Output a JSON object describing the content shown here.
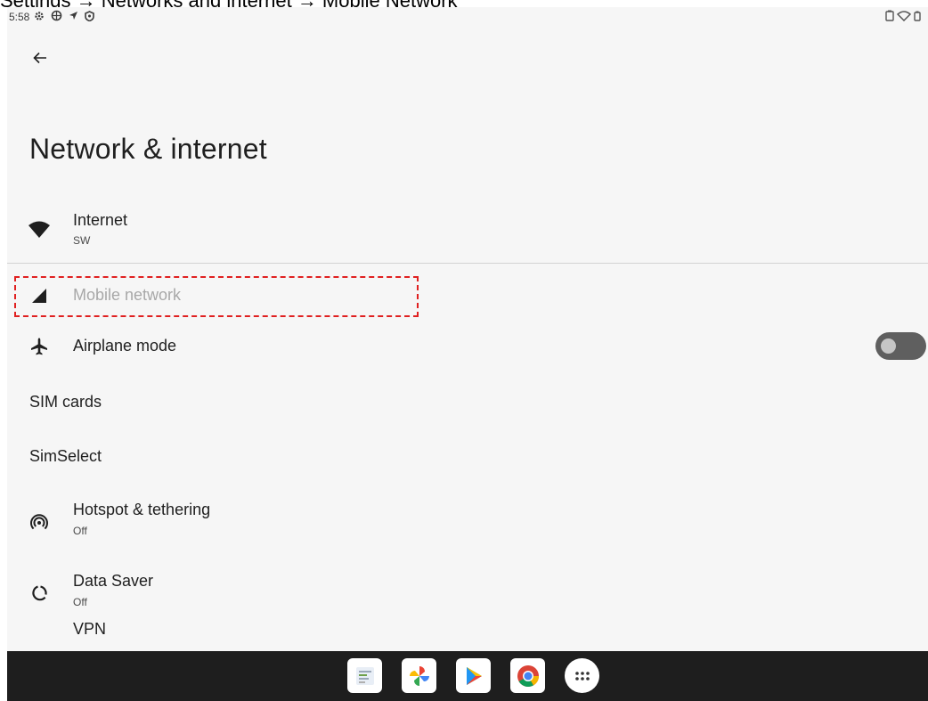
{
  "caption": "Settings → Networks and internet → Mobile Network",
  "status_bar": {
    "time": "5:58",
    "icons": [
      "settings-icon",
      "vpn-gear-icon",
      "location-arrow-icon",
      "shield-icon"
    ],
    "right_icons": [
      "battery-saver-icon",
      "wifi-icon",
      "battery-icon"
    ]
  },
  "page": {
    "title": "Network & internet"
  },
  "items": [
    {
      "title": "Internet",
      "subtitle": "SW",
      "icon": "wifi-icon"
    },
    {
      "title": "Mobile network",
      "icon": "cellular-signal-icon",
      "enabled": false
    },
    {
      "title": "Airplane mode",
      "icon": "airplane-icon",
      "toggle": false
    },
    {
      "title": "SIM cards"
    },
    {
      "title": "SimSelect"
    },
    {
      "title": "Hotspot & tethering",
      "subtitle": "Off",
      "icon": "hotspot-icon"
    },
    {
      "title": "Data Saver",
      "subtitle": "Off",
      "icon": "data-saver-icon"
    },
    {
      "title": "VPN"
    }
  ],
  "dock": {
    "apps": [
      "sheets-app-icon",
      "photos-app-icon",
      "play-store-app-icon",
      "chrome-app-icon",
      "app-drawer-icon"
    ]
  },
  "colors": {
    "highlight": "#e02020",
    "background": "#f6f6f6",
    "navbar": "#1e1e1e",
    "disabled_text": "#a8a8a8"
  }
}
